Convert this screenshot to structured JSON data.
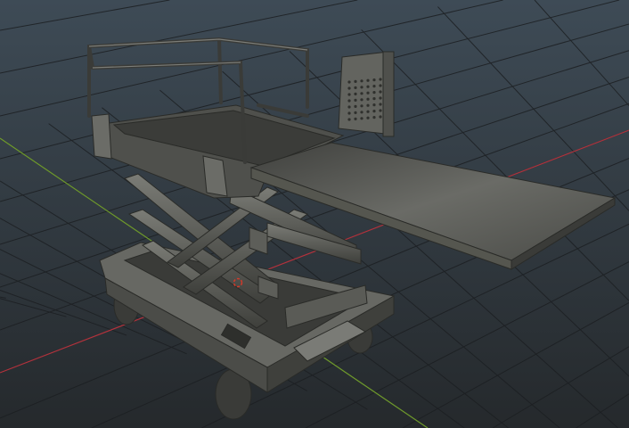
{
  "viewport": {
    "background_top": "#3e4b56",
    "background_bottom": "#25292c",
    "grid_color": "#1c1f22",
    "x_axis_color": "#b0333d",
    "y_axis_color": "#6f9a2c",
    "model_color": "#5b5d58",
    "cursor_color": "#d23a2a"
  }
}
